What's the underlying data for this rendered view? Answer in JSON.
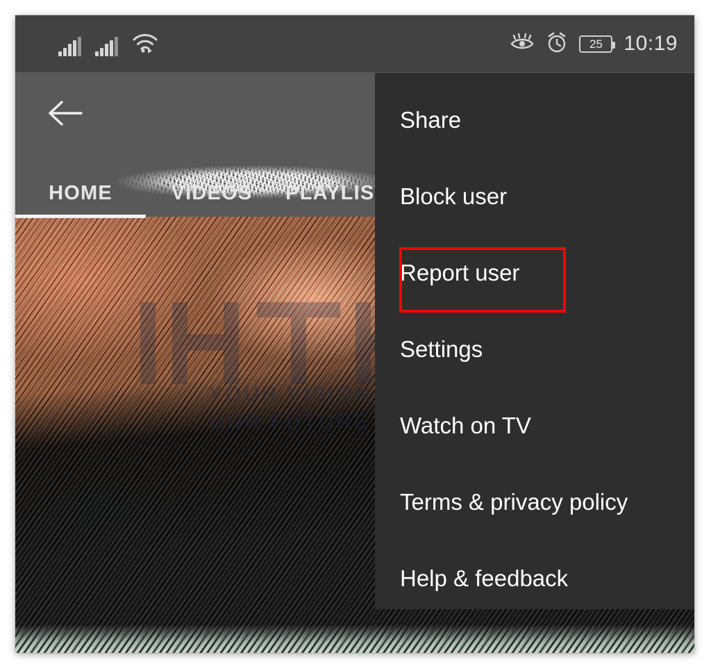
{
  "status_bar": {
    "signal_icon_1": "cellular-signal-icon",
    "signal_icon_2": "cellular-signal-icon",
    "wifi_icon": "wifi-icon",
    "eye_comfort_icon": "eye-icon",
    "alarm_icon": "alarm-clock-icon",
    "battery_level": "25",
    "battery_icon": "battery-icon",
    "time": "10:19"
  },
  "app_bar": {
    "back_icon": "back-arrow-icon",
    "title": "",
    "title_state": "redacted"
  },
  "tabs": [
    {
      "label": "HOME",
      "active": true
    },
    {
      "label": "VIDEOS",
      "active": false
    },
    {
      "label": "PLAYLISTS",
      "active": false
    }
  ],
  "overflow_menu": {
    "items": [
      {
        "label": "Share"
      },
      {
        "label": "Block user"
      },
      {
        "label": "Report user"
      },
      {
        "label": "Settings"
      },
      {
        "label": "Watch on TV"
      },
      {
        "label": "Terms & privacy policy"
      },
      {
        "label": "Help & feedback"
      }
    ],
    "highlighted_item": "Report user"
  },
  "annotation": {
    "highlight_color": "#ff0000"
  },
  "watermark": {
    "brand": "HI-TECH",
    "tagline_line1": "YOUR VISION",
    "tagline_line2": "OUR FUTURE"
  },
  "colors": {
    "status_bar_bg": "#424242",
    "app_bar_bg": "#595959",
    "menu_bg": "#2e2e2e",
    "text_primary": "#ffffff",
    "accent_red": "#ff0000"
  }
}
